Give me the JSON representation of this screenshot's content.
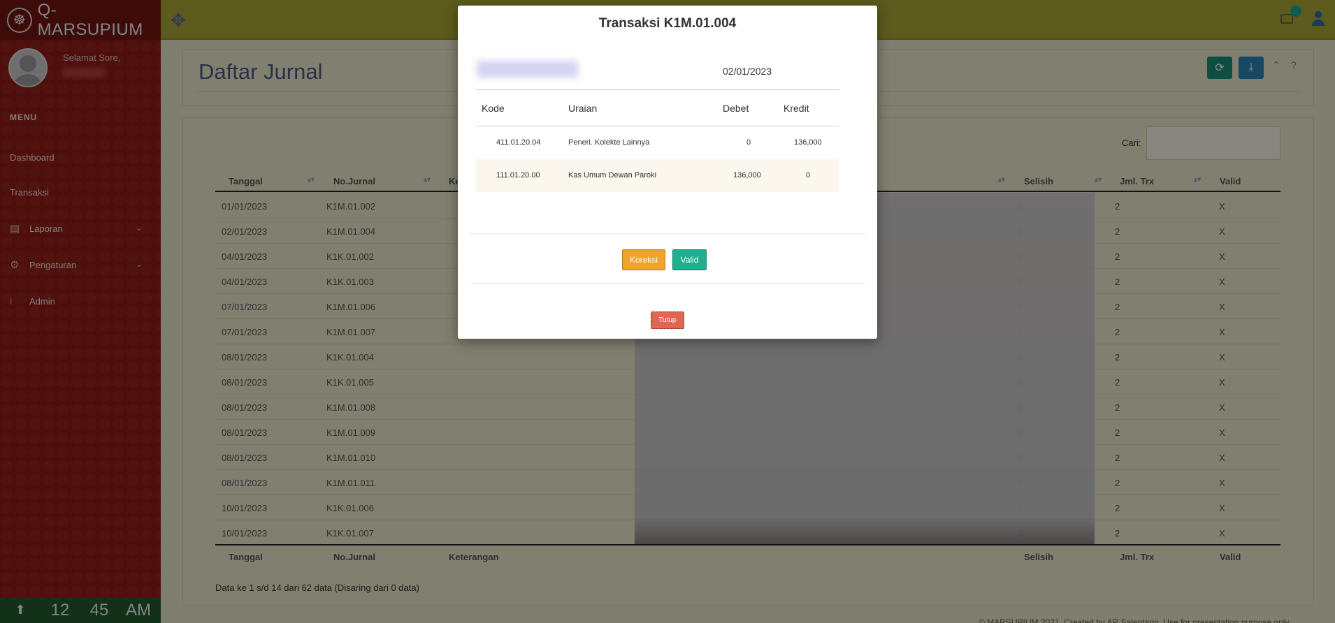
{
  "app": {
    "name": "Q-MARSUPIUM",
    "colors": {
      "topbar": "#a8a636",
      "sidebar": "#8f1a14",
      "brand": "#6f1410",
      "clock": "#235a2c"
    }
  },
  "topbar": {
    "icons": [
      "move-icon",
      "mail-icon",
      "user-icon"
    ]
  },
  "sidebar": {
    "greeting": "Selamat Sore,",
    "menu_title": "MENU",
    "items": [
      {
        "label": "Dashboard",
        "icon": ""
      },
      {
        "label": "Transaksi",
        "icon": ""
      },
      {
        "label": "Laporan",
        "icon": "file-icon",
        "caret": "chevron-down-icon"
      },
      {
        "label": "Pengaturan",
        "icon": "gear-icon",
        "caret": "chevron-down-icon"
      },
      {
        "label": "Admin",
        "icon": "info-icon"
      }
    ],
    "clock": {
      "hour": "12",
      "minute": "45",
      "ampm": "AM"
    }
  },
  "page": {
    "title": "Daftar Jurnal",
    "search_label": "Cari:",
    "search_value": "",
    "columns": [
      "Tanggal",
      "No.Jurnal",
      "Keterangan",
      "Selisih",
      "Jml. Trx",
      "Valid"
    ],
    "rows": [
      {
        "tanggal": "01/01/2023",
        "no": "K1M.01.002",
        "selisih": "0",
        "trx": "2",
        "valid": "X"
      },
      {
        "tanggal": "02/01/2023",
        "no": "K1M.01.004",
        "selisih": "0",
        "trx": "2",
        "valid": "X"
      },
      {
        "tanggal": "04/01/2023",
        "no": "K1K.01.002",
        "selisih": "0",
        "trx": "2",
        "valid": "X"
      },
      {
        "tanggal": "04/01/2023",
        "no": "K1K.01.003",
        "selisih": "0",
        "trx": "2",
        "valid": "X"
      },
      {
        "tanggal": "07/01/2023",
        "no": "K1M.01.006",
        "selisih": "0",
        "trx": "2",
        "valid": "X"
      },
      {
        "tanggal": "07/01/2023",
        "no": "K1M.01.007",
        "selisih": "0",
        "trx": "2",
        "valid": "X"
      },
      {
        "tanggal": "08/01/2023",
        "no": "K1K.01.004",
        "selisih": "0",
        "trx": "2",
        "valid": "X"
      },
      {
        "tanggal": "08/01/2023",
        "no": "K1K.01.005",
        "selisih": "0",
        "trx": "2",
        "valid": "X"
      },
      {
        "tanggal": "08/01/2023",
        "no": "K1M.01.008",
        "selisih": "0",
        "trx": "2",
        "valid": "X"
      },
      {
        "tanggal": "08/01/2023",
        "no": "K1M.01.009",
        "selisih": "0",
        "trx": "2",
        "valid": "X"
      },
      {
        "tanggal": "08/01/2023",
        "no": "K1M.01.010",
        "selisih": "0",
        "trx": "2",
        "valid": "X"
      },
      {
        "tanggal": "08/01/2023",
        "no": "K1M.01.011",
        "selisih": "0",
        "trx": "2",
        "valid": "X"
      },
      {
        "tanggal": "10/01/2023",
        "no": "K1K.01.006",
        "selisih": "0",
        "trx": "2",
        "valid": "X"
      },
      {
        "tanggal": "10/01/2023",
        "no": "K1K.01.007",
        "selisih": "0",
        "trx": "2",
        "valid": "X"
      }
    ],
    "info": "Data ke 1 s/d 14 dari 62 data (Disaring dari 0 data)",
    "footer": "© MARSUPIUM 2021. Created by AR Salentang. Use for presentation purpose only"
  },
  "modal": {
    "title": "Transaksi K1M.01.004",
    "date": "02/01/2023",
    "columns": [
      "Kode",
      "Uraian",
      "Debet",
      "Kredit"
    ],
    "rows": [
      {
        "kode": "411.01.20.04",
        "uraian": "Peneri. Kolekte Lainnya",
        "debet": "0",
        "kredit": "136,000"
      },
      {
        "kode": "111.01.20.00",
        "uraian": "Kas Umum Dewan Paroki",
        "debet": "136,000",
        "kredit": "0"
      }
    ],
    "buttons": {
      "koreksi": "Koreksi",
      "valid": "Valid",
      "tutup": "Tutup"
    },
    "colors": {
      "koreksi": "#f0a32a",
      "valid": "#1fae8e",
      "tutup": "#e06553"
    }
  }
}
